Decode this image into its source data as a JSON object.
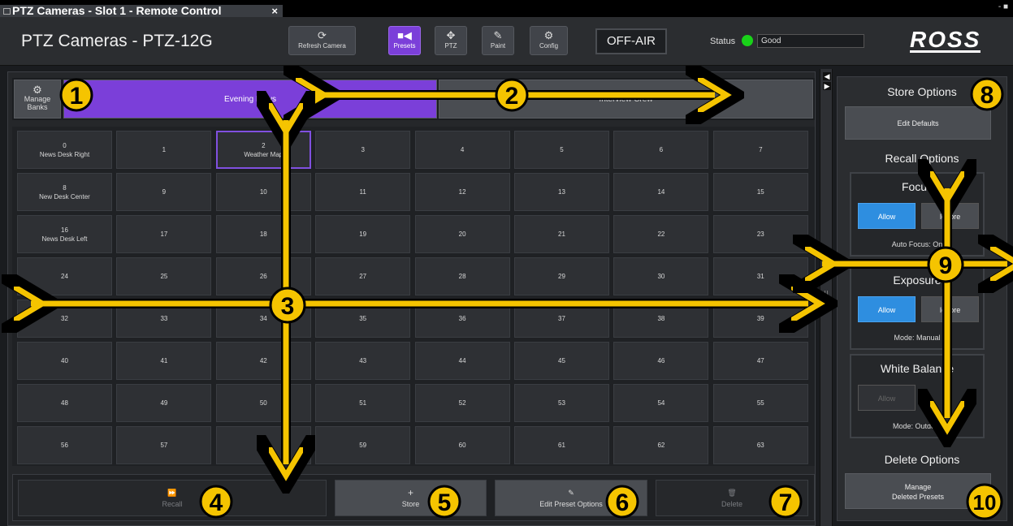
{
  "window": {
    "tab_title": "PTZ Cameras - Slot 1 - Remote Control",
    "close_glyph": "×",
    "controls": "- ■"
  },
  "header": {
    "app_title": "PTZ Cameras - PTZ-12G",
    "refresh_label": "Refresh Camera",
    "nav": [
      {
        "label": "Presets",
        "icon": "camera-icon"
      },
      {
        "label": "PTZ",
        "icon": "move-arrows-icon"
      },
      {
        "label": "Paint",
        "icon": "paint-brush-icon"
      },
      {
        "label": "Config",
        "icon": "gear-icon"
      }
    ],
    "offair_label": "OFF-AIR",
    "status_label": "Status",
    "status_value": "Good",
    "status_color": "#19d219",
    "logo": "ROSS"
  },
  "banks": {
    "manage_label_1": "Manage",
    "manage_label_2": "Banks",
    "items": [
      "Evening News",
      "Interview Crew"
    ],
    "accent": "#7b3fd9"
  },
  "presets": [
    [
      "0",
      "News Desk Right"
    ],
    [
      "1",
      ""
    ],
    [
      "2",
      "Weather Map"
    ],
    [
      "3",
      ""
    ],
    [
      "4",
      ""
    ],
    [
      "5",
      ""
    ],
    [
      "6",
      ""
    ],
    [
      "7",
      ""
    ],
    [
      "8",
      "New Desk Center"
    ],
    [
      "9",
      ""
    ],
    [
      "10",
      ""
    ],
    [
      "11",
      ""
    ],
    [
      "12",
      ""
    ],
    [
      "13",
      ""
    ],
    [
      "14",
      ""
    ],
    [
      "15",
      ""
    ],
    [
      "16",
      "News Desk Left"
    ],
    [
      "17",
      ""
    ],
    [
      "18",
      ""
    ],
    [
      "19",
      ""
    ],
    [
      "20",
      ""
    ],
    [
      "21",
      ""
    ],
    [
      "22",
      ""
    ],
    [
      "23",
      ""
    ],
    [
      "24",
      ""
    ],
    [
      "25",
      ""
    ],
    [
      "26",
      ""
    ],
    [
      "27",
      ""
    ],
    [
      "28",
      ""
    ],
    [
      "29",
      ""
    ],
    [
      "30",
      ""
    ],
    [
      "31",
      ""
    ],
    [
      "32",
      ""
    ],
    [
      "33",
      ""
    ],
    [
      "34",
      ""
    ],
    [
      "35",
      ""
    ],
    [
      "36",
      ""
    ],
    [
      "37",
      ""
    ],
    [
      "38",
      ""
    ],
    [
      "39",
      ""
    ],
    [
      "40",
      ""
    ],
    [
      "41",
      ""
    ],
    [
      "42",
      ""
    ],
    [
      "43",
      ""
    ],
    [
      "44",
      ""
    ],
    [
      "45",
      ""
    ],
    [
      "46",
      ""
    ],
    [
      "47",
      ""
    ],
    [
      "48",
      ""
    ],
    [
      "49",
      ""
    ],
    [
      "50",
      ""
    ],
    [
      "51",
      ""
    ],
    [
      "52",
      ""
    ],
    [
      "53",
      ""
    ],
    [
      "54",
      ""
    ],
    [
      "55",
      ""
    ],
    [
      "56",
      ""
    ],
    [
      "57",
      ""
    ],
    [
      "58",
      ""
    ],
    [
      "59",
      ""
    ],
    [
      "60",
      ""
    ],
    [
      "61",
      ""
    ],
    [
      "62",
      ""
    ],
    [
      "63",
      ""
    ]
  ],
  "selected_preset": "2",
  "actions": {
    "recall": "Recall",
    "store": "Store",
    "edit": "Edit Preset Options",
    "delete": "Delete"
  },
  "right": {
    "store_title": "Store Options",
    "edit_defaults": "Edit Defaults",
    "recall_title": "Recall Options",
    "focus": {
      "title": "Focus",
      "allow": "Allow",
      "ignore": "Ignore",
      "note": "Auto Focus: On"
    },
    "exposure": {
      "title": "Exposure",
      "allow": "Allow",
      "ignore": "Ignore",
      "note": "Mode: Manual"
    },
    "white_balance": {
      "title": "White Balance",
      "allow": "Allow",
      "note": "Mode: Outdoor"
    },
    "delete_title": "Delete Options",
    "manage_deleted_1": "Manage",
    "manage_deleted_2": "Deleted Presets",
    "allow_color": "#2e8ee0"
  },
  "callouts": [
    "1",
    "2",
    "3",
    "4",
    "5",
    "6",
    "7",
    "8",
    "9",
    "10"
  ],
  "callout_color": "#f5c400"
}
